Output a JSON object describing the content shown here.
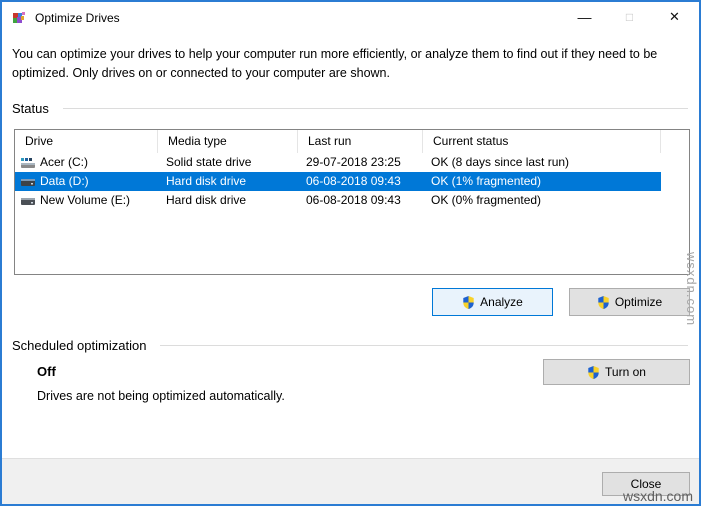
{
  "window": {
    "title": "Optimize Drives",
    "controls": {
      "minimize": "—",
      "maximize": "□",
      "close": "✕"
    }
  },
  "description": "You can optimize your drives to help your computer run more efficiently, or analyze them to find out if they need to be optimized. Only drives on or connected to your computer are shown.",
  "status": {
    "label": "Status",
    "columns": [
      "Drive",
      "Media type",
      "Last run",
      "Current status"
    ],
    "rows": [
      {
        "drive": "Acer (C:)",
        "media": "Solid state drive",
        "last_run": "29-07-2018 23:25",
        "status": "OK (8 days since last run)"
      },
      {
        "drive": "Data (D:)",
        "media": "Hard disk drive",
        "last_run": "06-08-2018 09:43",
        "status": "OK (1% fragmented)"
      },
      {
        "drive": "New Volume (E:)",
        "media": "Hard disk drive",
        "last_run": "06-08-2018 09:43",
        "status": "OK (0% fragmented)"
      }
    ],
    "selected_row": 1,
    "analyze_label": "Analyze",
    "optimize_label": "Optimize"
  },
  "schedule": {
    "label": "Scheduled optimization",
    "state": "Off",
    "detail": "Drives are not being optimized automatically.",
    "turn_on_label": "Turn on"
  },
  "footer": {
    "close_label": "Close"
  },
  "watermark": "wsxdn.com",
  "colors": {
    "window_border": "#2b7cd3",
    "selection_blue": "#0078d7",
    "default_button_bg": "#e9f3fc",
    "default_button_border": "#0078d7",
    "button_bg": "#e1e1e1",
    "button_border": "#adadad",
    "footer_bg": "#f0f0f0",
    "shield_blue": "#1e62d0",
    "shield_yellow": "#f8d22a"
  }
}
